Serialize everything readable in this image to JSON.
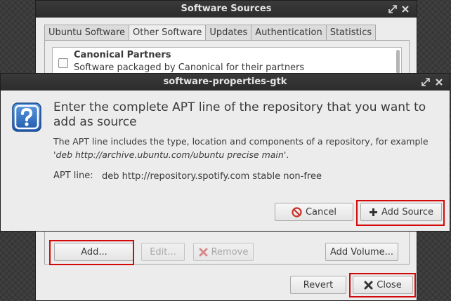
{
  "software_sources": {
    "title": "Software Sources",
    "tabs": [
      {
        "label": "Ubuntu Software",
        "active": false
      },
      {
        "label": "Other Software",
        "active": true
      },
      {
        "label": "Updates",
        "active": false
      },
      {
        "label": "Authentication",
        "active": false
      },
      {
        "label": "Statistics",
        "active": false
      }
    ],
    "sources": [
      {
        "title": "Canonical Partners",
        "description": "Software packaged by Canonical for their partners",
        "checked": false
      }
    ],
    "buttons": {
      "add": "Add...",
      "edit": "Edit...",
      "remove": "Remove",
      "add_volume": "Add Volume...",
      "revert": "Revert",
      "close": "Close"
    }
  },
  "dialog": {
    "title": "software-properties-gtk",
    "heading": "Enter the complete APT line of the repository that you want to add as source",
    "body_intro": "The APT line includes the type, location and components of a repository, for example",
    "example_quote_open": "'",
    "example_line": "deb http://archive.ubuntu.com/ubuntu precise main",
    "example_quote_close": "'.",
    "apt_label": "APT line:",
    "apt_value": "deb http://repository.spotify.com stable non-free",
    "buttons": {
      "cancel": "Cancel",
      "add_source": "Add Source"
    }
  },
  "colors": {
    "highlight": "#d20a0a",
    "titlebar": "#2c2c2c",
    "window_bg": "#ececec",
    "icon_blue": "#2d6fc0",
    "remove_red": "#c23b3b",
    "cancel_red": "#c8322a"
  },
  "icons": {
    "title_maximize": "maximize-icon",
    "title_close": "close-icon",
    "dialog": "question-icon",
    "cancel": "cancel-icon",
    "add_source": "plus-icon",
    "remove": "remove-icon",
    "close": "close-x-icon"
  },
  "highlights": [
    "add-button",
    "close-button",
    "add-source-button"
  ]
}
